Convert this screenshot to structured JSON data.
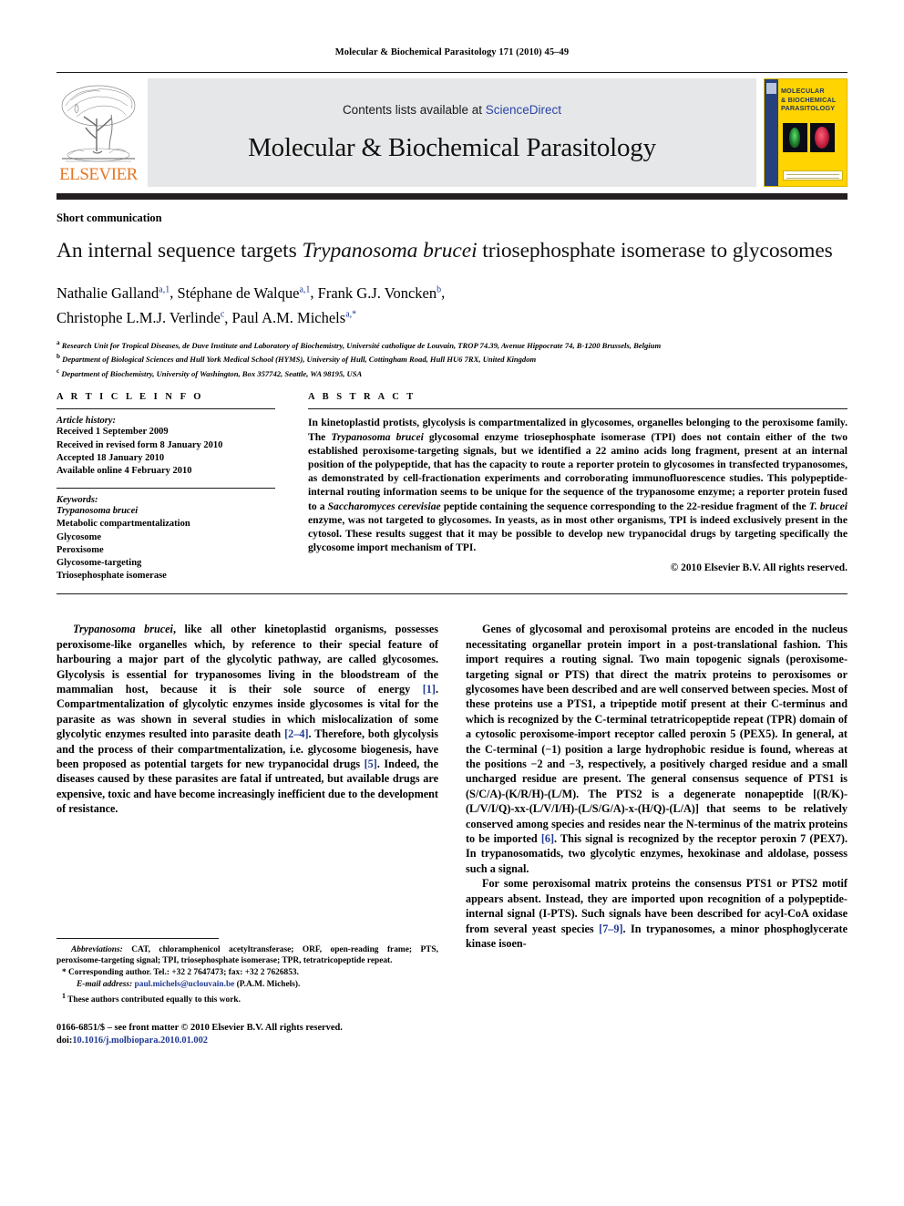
{
  "running_head": "Molecular & Biochemical Parasitology 171 (2010) 45–49",
  "masthead": {
    "publisher_name": "ELSEVIER",
    "contents_prefix": "Contents lists available at ",
    "sciencedirect": "ScienceDirect",
    "journal_title": "Molecular & Biochemical Parasitology",
    "cover_title_line1": "MOLECULAR",
    "cover_title_line2": "& BIOCHEMICAL",
    "cover_title_line3": "PARASITOLOGY",
    "link_color": "#2b45a8",
    "brand_orange": "#E87722",
    "cover_yellow": "#FFD400",
    "cover_band_blue": "#26417e"
  },
  "article": {
    "doctype": "Short communication",
    "title_part1": "An internal sequence targets ",
    "title_italic": "Trypanosoma brucei",
    "title_part2": " triosephosphate isomerase to glycosomes",
    "authors": [
      {
        "name": "Nathalie Galland",
        "marks": "a,1"
      },
      {
        "name": "Stéphane de Walque",
        "marks": "a,1"
      },
      {
        "name": "Frank G.J. Voncken",
        "marks": "b"
      },
      {
        "name": "Christophe L.M.J. Verlinde",
        "marks": "c"
      },
      {
        "name": "Paul A.M. Michels",
        "marks": "a,*"
      }
    ],
    "affiliations": [
      {
        "mark": "a",
        "text": "Research Unit for Tropical Diseases, de Duve Institute and Laboratory of Biochemistry, Université catholique de Louvain, TROP 74.39, Avenue Hippocrate 74, B-1200 Brussels, Belgium"
      },
      {
        "mark": "b",
        "text": "Department of Biological Sciences and Hull York Medical School (HYMS), University of Hull, Cottingham Road, Hull HU6 7RX, United Kingdom"
      },
      {
        "mark": "c",
        "text": "Department of Biochemistry, University of Washington, Box 357742, Seattle, WA 98195, USA"
      }
    ]
  },
  "info": {
    "heading": "A R T I C L E    I N F O",
    "history_label": "Article history:",
    "history": [
      "Received 1 September 2009",
      "Received in revised form 8 January 2010",
      "Accepted 18 January 2010",
      "Available online 4 February 2010"
    ],
    "keywords_label": "Keywords:",
    "keywords": [
      "Trypanosoma brucei",
      "Metabolic compartmentalization",
      "Glycosome",
      "Peroxisome",
      "Glycosome-targeting",
      "Triosephosphate isomerase"
    ]
  },
  "abstract": {
    "heading": "A B S T R A C T",
    "seg1": "In kinetoplastid protists, glycolysis is compartmentalized in glycosomes, organelles belonging to the peroxisome family. The ",
    "seg_i1": "Trypanosoma brucei",
    "seg2": " glycosomal enzyme triosephosphate isomerase (TPI) does not contain either of the two established peroxisome-targeting signals, but we identified a 22 amino acids long fragment, present at an internal position of the polypeptide, that has the capacity to route a reporter protein to glycosomes in transfected trypanosomes, as demonstrated by cell-fractionation experiments and corroborating immunofluorescence studies. This polypeptide-internal routing information seems to be unique for the sequence of the trypanosome enzyme; a reporter protein fused to a ",
    "seg_i2": "Saccharomyces cerevisiae",
    "seg3": " peptide containing the sequence corresponding to the 22-residue fragment of the ",
    "seg_i3": "T. brucei",
    "seg4": " enzyme, was not targeted to glycosomes. In yeasts, as in most other organisms, TPI is indeed exclusively present in the cytosol. These results suggest that it may be possible to develop new trypanocidal drugs by targeting specifically the glycosome import mechanism of TPI.",
    "copyright": "© 2010 Elsevier B.V. All rights reserved."
  },
  "body": {
    "left_p1_i": "Trypanosoma brucei",
    "left_p1_a": ", like all other kinetoplastid organisms, possesses peroxisome-like organelles which, by reference to their special feature of harbouring a major part of the glycolytic pathway, are called glycosomes. Glycolysis is essential for trypanosomes living in the bloodstream of the mammalian host, because it is their sole source of energy ",
    "left_p1_r1": "[1]",
    "left_p1_b": ". Compartmentalization of glycolytic enzymes inside glycosomes is vital for the parasite as was shown in several studies in which mislocalization of some glycolytic enzymes resulted into parasite death ",
    "left_p1_r2": "[2–4]",
    "left_p1_c": ". Therefore, both glycolysis and the process of their compartmentalization, i.e. glycosome biogenesis, have been proposed as potential targets for new trypanocidal drugs ",
    "left_p1_r3": "[5]",
    "left_p1_d": ". Indeed, the diseases caused by these parasites are fatal if untreated, but available drugs are expensive, toxic and have become increasingly inefficient due to the development of resistance.",
    "right_p1_a": "Genes of glycosomal and peroxisomal proteins are encoded in the nucleus necessitating organellar protein import in a post-translational fashion. This import requires a routing signal. Two main topogenic signals (peroxisome-targeting signal or PTS) that direct the matrix proteins to peroxisomes or glycosomes have been described and are well conserved between species. Most of these proteins use a PTS1, a tripeptide motif present at their C-terminus and which is recognized by the C-terminal tetratricopeptide repeat (TPR) domain of a cytosolic peroxisome-import receptor called peroxin 5 (PEX5). In general, at the C-terminal (−1) position a large hydrophobic residue is found, whereas at the positions −2 and −3, respectively, a positively charged residue and a small uncharged residue are present. The general consensus sequence of PTS1 is (S/C/A)-(K/R/H)-(L/M). The PTS2 is a degenerate nonapeptide [(R/K)-(L/V/I/Q)-xx-(L/V/I/H)-(L/S/G/A)-x-(H/Q)-(L/A)] that seems to be relatively conserved among species and resides near the N-terminus of the matrix proteins to be imported ",
    "right_p1_r1": "[6]",
    "right_p1_b": ". This signal is recognized by the receptor peroxin 7 (PEX7). In trypanosomatids, two glycolytic enzymes, hexokinase and aldolase, possess such a signal.",
    "right_p2_a": "For some peroxisomal matrix proteins the consensus PTS1 or PTS2 motif appears absent. Instead, they are imported upon recognition of a polypeptide-internal signal (I-PTS). Such signals have been described for acyl-CoA oxidase from several yeast species ",
    "right_p2_r1": "[7–9]",
    "right_p2_b": ". In trypanosomes, a minor phosphoglycerate kinase isoen-"
  },
  "footnotes": {
    "abbrev_label": "Abbreviations:",
    "abbrev_text": "  CAT, chloramphenicol acetyltransferase; ORF, open-reading frame; PTS, peroxisome-targeting signal; TPI, triosephosphate isomerase; TPR, tetratricopeptide repeat.",
    "corresponding_mark": "*",
    "corresponding_text": " Corresponding author. Tel.: +32 2 7647473; fax: +32 2 7626853.",
    "email_label": "E-mail address:",
    "email": "paul.michels@uclouvain.be",
    "email_suffix": " (P.A.M. Michels).",
    "equal_mark": "1",
    "equal_text": " These authors contributed equally to this work."
  },
  "imprint": {
    "line1": "0166-6851/$ – see front matter © 2010 Elsevier B.V. All rights reserved.",
    "doi_label": "doi:",
    "doi": "10.1016/j.molbiopara.2010.01.002"
  }
}
